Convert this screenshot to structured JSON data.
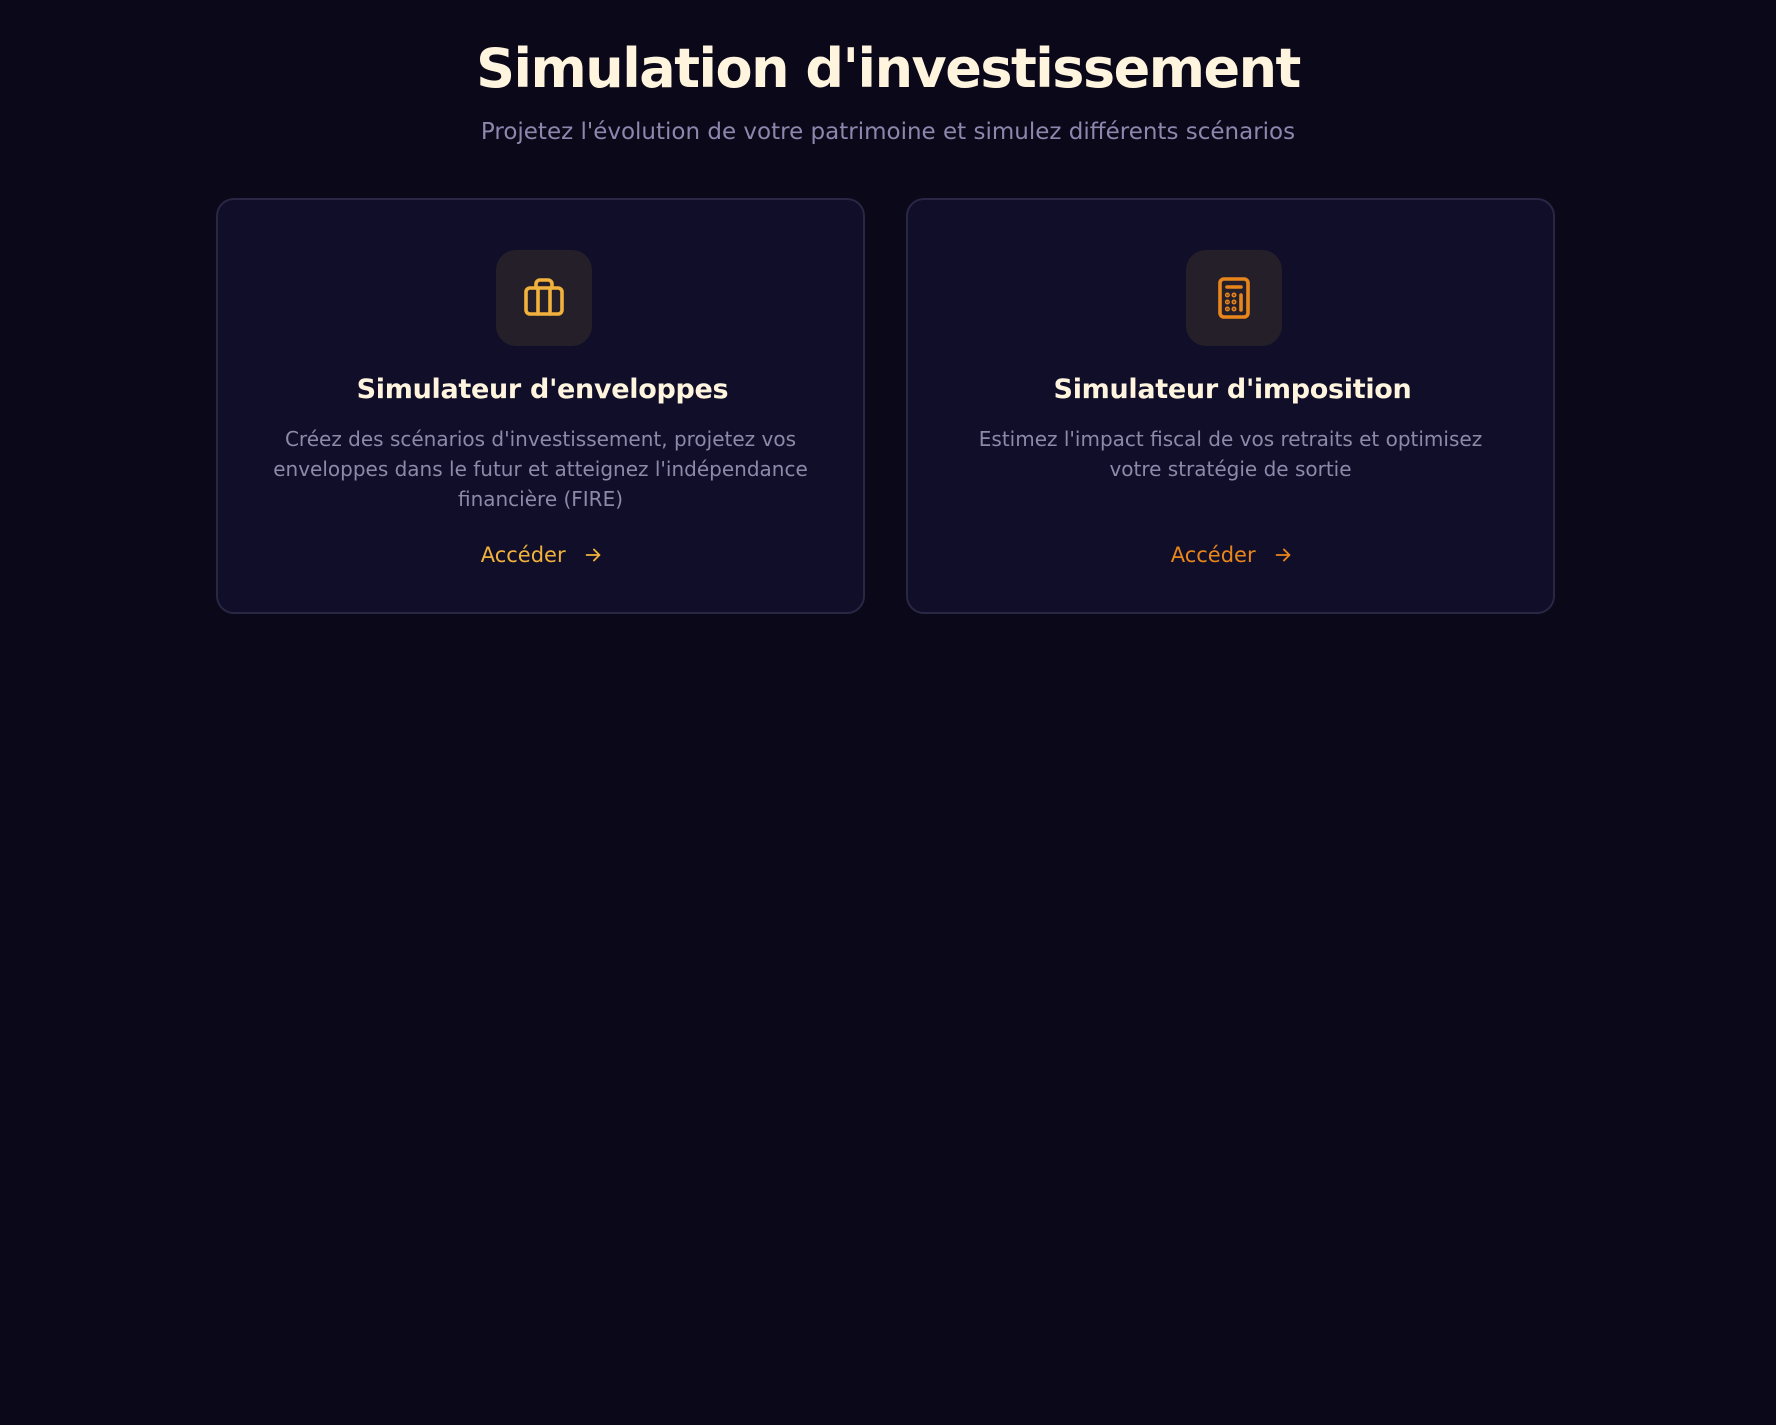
{
  "header": {
    "title": "Simulation d'investissement",
    "subtitle": "Projetez l'évolution de votre patrimoine et simulez différents scénarios"
  },
  "cards": [
    {
      "icon": "briefcase-icon",
      "title": "Simulateur d'enveloppes",
      "description": "Créez des scénarios d'investissement, projetez vos enveloppes dans le futur et atteignez l'indépendance financière (FIRE)",
      "link_label": "Accéder",
      "accent_color": "#f0b23c"
    },
    {
      "icon": "calculator-icon",
      "title": "Simulateur d'imposition",
      "description": "Estimez l'impact fiscal de vos retraits et optimisez votre stratégie de sortie",
      "link_label": "Accéder",
      "accent_color": "#e8861c"
    }
  ],
  "colors": {
    "background": "#0a0819",
    "card_background": "#110e29",
    "card_border": "#2a2744",
    "title_text": "#fff4de",
    "muted_text": "#8e88a9"
  }
}
